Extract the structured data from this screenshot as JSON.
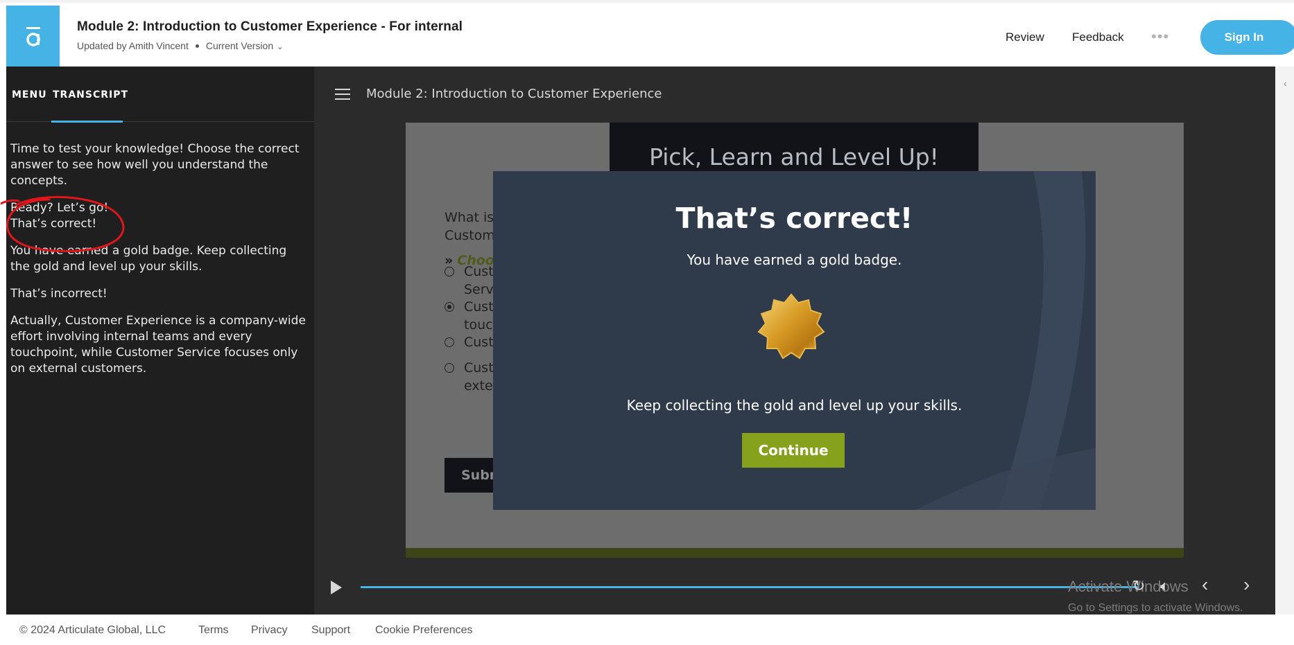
{
  "header": {
    "title": "Module 2: Introduction to Customer Experience - For internal",
    "updated_by": "Updated by Amith Vincent",
    "version": "Current Version",
    "nav_review": "Review",
    "nav_feedback": "Feedback",
    "more": "•••",
    "signin": "Sign In"
  },
  "sidebar": {
    "tab_menu": "MENU",
    "tab_transcript": "TRANSCRIPT",
    "transcript": {
      "p1": "Time to test your knowledge! Choose the correct answer to see how well you understand the concepts.",
      "p2a": "Ready? Let’s go!",
      "p2b": "That’s correct!",
      "p3": "You have earned a gold badge. Keep collecting the gold and level up your skills.",
      "p4": "That’s incorrect!",
      "p5": "Actually, Customer Experience is a company-wide effort involving internal teams and every touchpoint, while Customer Service focuses only on external customers."
    }
  },
  "player": {
    "title": "Module 2: Introduction to Customer Experience",
    "slide": {
      "banner": "Pick, Learn and Level Up!",
      "question_l1": "What is",
      "question_l2": "Custom",
      "choose": "Choo",
      "options": [
        {
          "l1": "Cust",
          "l2": "Serv",
          "selected": false
        },
        {
          "l1": "Cust",
          "l2": "touc",
          "selected": true
        },
        {
          "l1": "Cust",
          "l2": "",
          "selected": false
        },
        {
          "l1": "Cust",
          "l2": "exte",
          "selected": false
        }
      ],
      "submit": "Subm"
    },
    "modal": {
      "title": "That’s correct!",
      "subtitle": "You have earned a gold badge.",
      "keep": "Keep collecting the gold and level up your skills.",
      "continue": "Continue"
    },
    "activate_title": "Activate Windows",
    "activate_sub": "Go to Settings to activate Windows."
  },
  "footer": {
    "copyright": "© 2024 Articulate Global, LLC",
    "terms": "Terms",
    "privacy": "Privacy",
    "support": "Support",
    "cookie": "Cookie Preferences"
  },
  "colors": {
    "accent": "#46b3e6",
    "continue": "#86a21c",
    "modal_bg": "#2f3a4b",
    "annotation": "#e0161b"
  }
}
